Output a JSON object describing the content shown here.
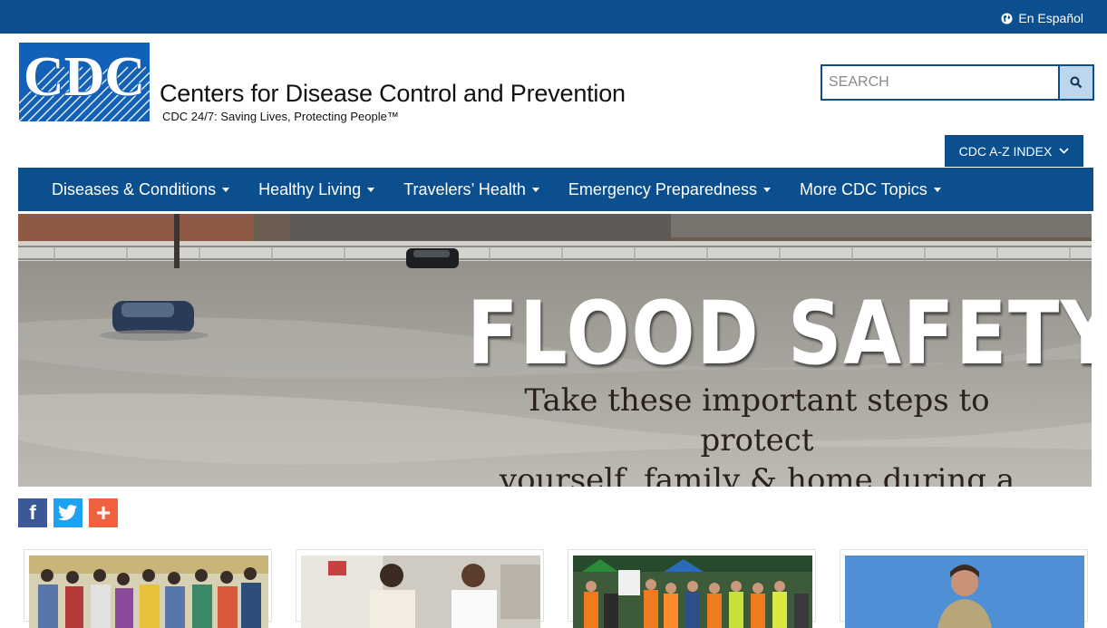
{
  "header": {
    "language_link": "En Español",
    "logo_text": "CDC",
    "title": "Centers for Disease Control and Prevention",
    "tagline": "CDC 24/7: Saving Lives, Protecting People™"
  },
  "search": {
    "placeholder": "SEARCH"
  },
  "az_index": {
    "label": "CDC A-Z INDEX"
  },
  "nav": {
    "items": [
      {
        "label": "Diseases & Conditions"
      },
      {
        "label": "Healthy Living"
      },
      {
        "label": "Travelers’ Health"
      },
      {
        "label": "Emergency Preparedness"
      },
      {
        "label": "More CDC Topics"
      }
    ]
  },
  "hero": {
    "title": "FLOOD SAFETY",
    "subtitle_line1": "Take these important steps to protect",
    "subtitle_line2": "yourself, family & home during a flood."
  },
  "social": {
    "facebook": "f",
    "plus": "+"
  },
  "colors": {
    "brand_blue": "#0b4f8f",
    "logo_blue": "#1360b8",
    "facebook": "#3b5998",
    "twitter": "#1da1f2",
    "share": "#f0613d"
  }
}
